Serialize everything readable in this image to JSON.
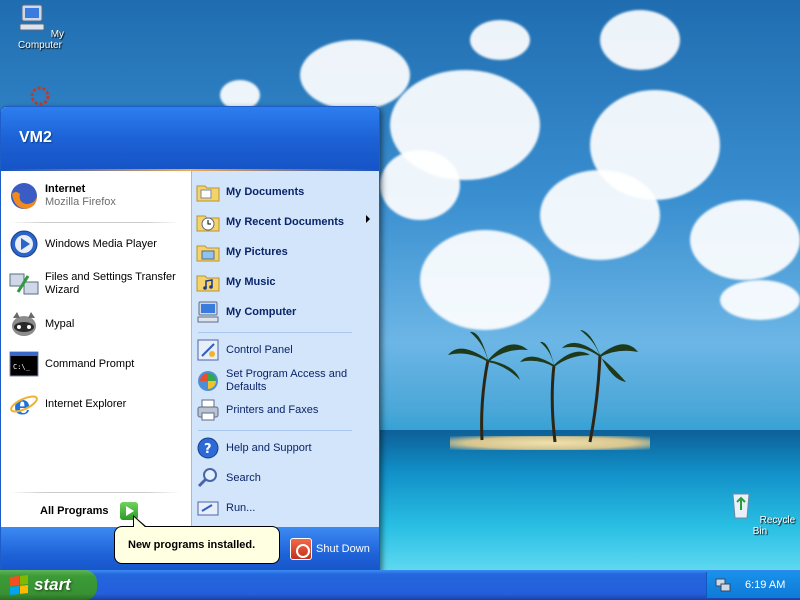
{
  "desktop": {
    "icons": [
      {
        "label": "My Computer",
        "icon": "my-computer-icon"
      },
      {
        "label": "Recycle Bin",
        "icon": "recycle-bin-icon"
      }
    ]
  },
  "start_menu": {
    "user_name": "VM2",
    "pinned": [
      {
        "title": "Internet",
        "subtitle": "Mozilla Firefox",
        "icon": "firefox-icon"
      }
    ],
    "recent_programs": [
      {
        "label": "Windows Media Player",
        "icon": "media-player-icon"
      },
      {
        "label": "Files and Settings Transfer Wizard",
        "icon": "transfer-wizard-icon"
      },
      {
        "label": "Mypal",
        "icon": "mypal-icon"
      },
      {
        "label": "Command Prompt",
        "icon": "command-prompt-icon"
      },
      {
        "label": "Internet Explorer",
        "icon": "internet-explorer-icon"
      }
    ],
    "all_programs_label": "All Programs",
    "places": [
      {
        "label": "My Documents",
        "icon": "folder-icon"
      },
      {
        "label": "My Recent Documents",
        "icon": "recent-documents-icon",
        "has_submenu": true
      },
      {
        "label": "My Pictures",
        "icon": "pictures-folder-icon"
      },
      {
        "label": "My Music",
        "icon": "music-folder-icon"
      },
      {
        "label": "My Computer",
        "icon": "my-computer-icon"
      }
    ],
    "settings": [
      {
        "label": "Control Panel",
        "icon": "control-panel-icon"
      },
      {
        "label": "Set Program Access and Defaults",
        "icon": "program-defaults-icon"
      },
      {
        "label": "Printers and Faxes",
        "icon": "printer-icon"
      }
    ],
    "tools": [
      {
        "label": "Help and Support",
        "icon": "help-icon"
      },
      {
        "label": "Search",
        "icon": "search-icon"
      },
      {
        "label": "Run...",
        "icon": "run-icon"
      }
    ],
    "shutdown_label": "Shut Down"
  },
  "balloon": {
    "text": "New programs installed."
  },
  "taskbar": {
    "start_label": "start",
    "clock": "6:19 AM"
  },
  "colors": {
    "taskbar_blue": "#245edb",
    "start_green": "#3c9b37",
    "menu_right_panel": "#d3e5fa"
  }
}
